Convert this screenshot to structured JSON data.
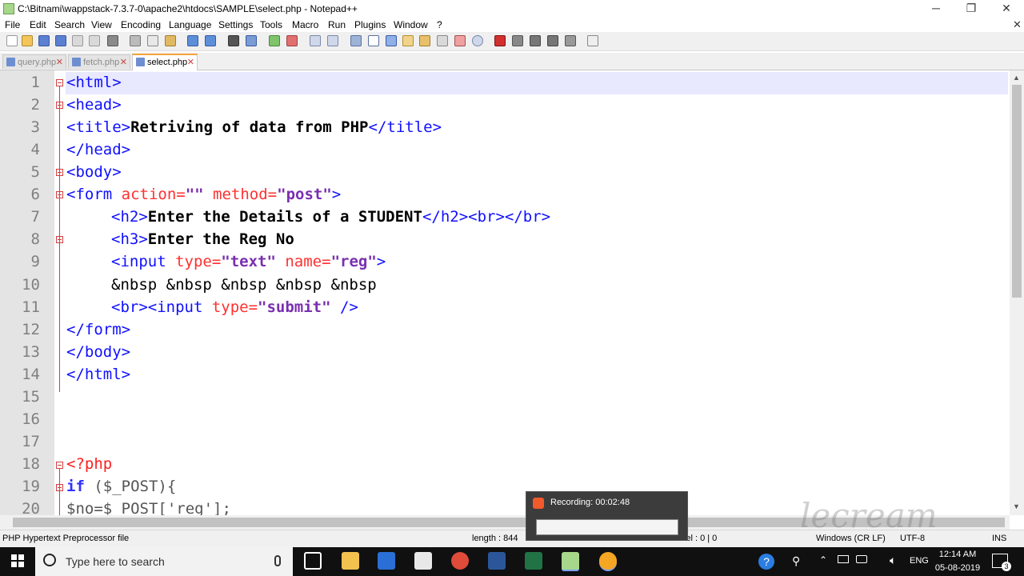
{
  "window": {
    "title": "C:\\Bitnami\\wappstack-7.3.7-0\\apache2\\htdocs\\SAMPLE\\select.php - Notepad++",
    "min": "─",
    "max": "❐",
    "close": "✕"
  },
  "menu": [
    "File",
    "Edit",
    "Search",
    "View",
    "Encoding",
    "Language",
    "Settings",
    "Tools",
    "Macro",
    "Run",
    "Plugins",
    "Window",
    "?"
  ],
  "menu_close": "✕",
  "tabs": [
    {
      "label": "query.php",
      "active": false
    },
    {
      "label": "fetch.php",
      "active": false
    },
    {
      "label": "select.php",
      "active": true
    }
  ],
  "tab_close": "✕",
  "lines": [
    "1",
    "2",
    "3",
    "4",
    "5",
    "6",
    "7",
    "8",
    "9",
    "10",
    "11",
    "12",
    "13",
    "14",
    "15",
    "16",
    "17",
    "18",
    "19",
    "20"
  ],
  "code": {
    "l1": "<html>",
    "l2": "<head>",
    "l3a": "<title>",
    "l3b": "Retriving of data from PHP",
    "l3c": "</title>",
    "l4": "</head>",
    "l5": "<body>",
    "l6a": "<form",
    "l6b": " action=",
    "l6c": "\"\"",
    "l6d": " method=",
    "l6e": "\"post\"",
    "l6f": ">",
    "l7a": "<h2>",
    "l7b": "Enter the Details of a STUDENT",
    "l7c": "</h2><br></br>",
    "l8a": "<h3>",
    "l8b": "Enter the Reg No",
    "l9a": "<input",
    "l9b": " type=",
    "l9c": "\"text\"",
    "l9d": " name=",
    "l9e": "\"reg\"",
    "l9f": ">",
    "l10": "&nbsp &nbsp &nbsp &nbsp &nbsp",
    "l11a": "<br><input",
    "l11b": " type=",
    "l11c": "\"submit\"",
    "l11d": " />",
    "l12": "</form>",
    "l13": "</body>",
    "l14": "</html>",
    "l18": "<?php",
    "l19a": "if",
    "l19b": " ($_POST){",
    "l20": "$no=$_POST['reg'];"
  },
  "status": {
    "filetype": "PHP Hypertext Preprocessor file",
    "length": "length : 844",
    "sel": "Sel : 0 | 0",
    "eol": "Windows (CR LF)",
    "encoding": "UTF-8",
    "mode": "INS"
  },
  "recording": {
    "label": "Recording:",
    "time": "00:02:48"
  },
  "taskbar": {
    "search_placeholder": "Type here to search",
    "time": "12:14 AM",
    "date": "05-08-2019",
    "lang": "ENG",
    "notif_count": "3"
  },
  "colors": {
    "accent_tab": "#f1a43c",
    "tag": "#1010ff",
    "attr": "#ff3030",
    "value": "#7a2fb0"
  },
  "watermark": "lecream"
}
